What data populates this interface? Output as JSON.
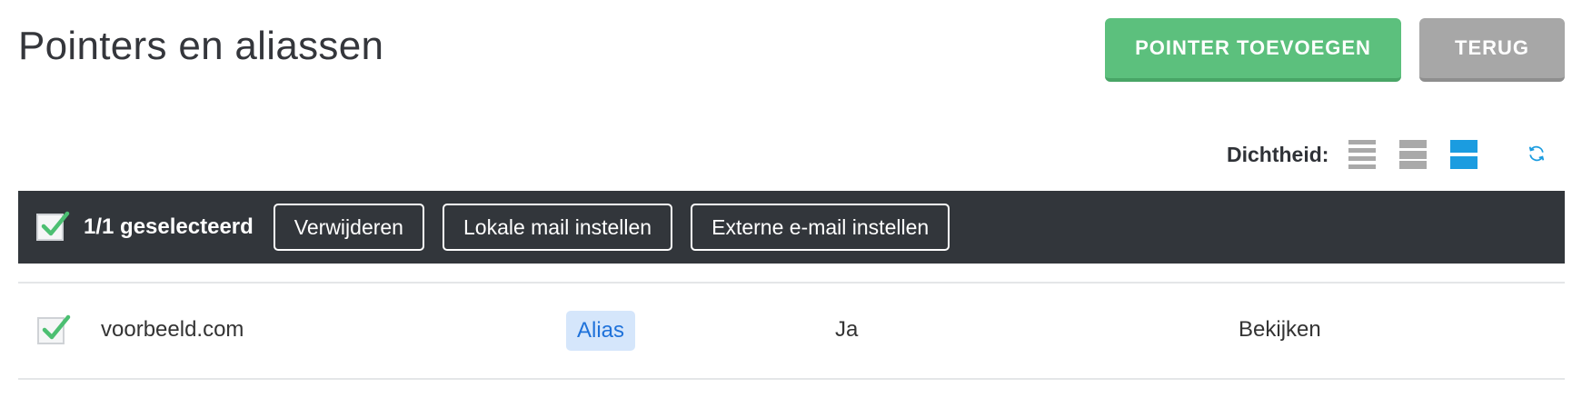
{
  "header": {
    "title": "Pointers en aliassen",
    "add_button": "POINTER TOEVOEGEN",
    "back_button": "TERUG"
  },
  "density": {
    "label": "Dichtheid:",
    "options": [
      "compact",
      "normal",
      "wide"
    ],
    "selected": "wide",
    "accent_color": "#1b9ce0"
  },
  "bulk_actions": {
    "selected_text": "1/1 geselecteerd",
    "buttons": [
      "Verwijderen",
      "Lokale mail instellen",
      "Externe e-mail instellen"
    ]
  },
  "table": {
    "rows": [
      {
        "checked": true,
        "domain": "voorbeeld.com",
        "type": "Alias",
        "value": "Ja",
        "action": "Bekijken"
      }
    ]
  },
  "colors": {
    "primary_green": "#5cc07d",
    "gray_button": "#a7a7a7",
    "bar_dark": "#32363b",
    "badge_bg": "#d5e6fb",
    "badge_text": "#1f72da"
  }
}
